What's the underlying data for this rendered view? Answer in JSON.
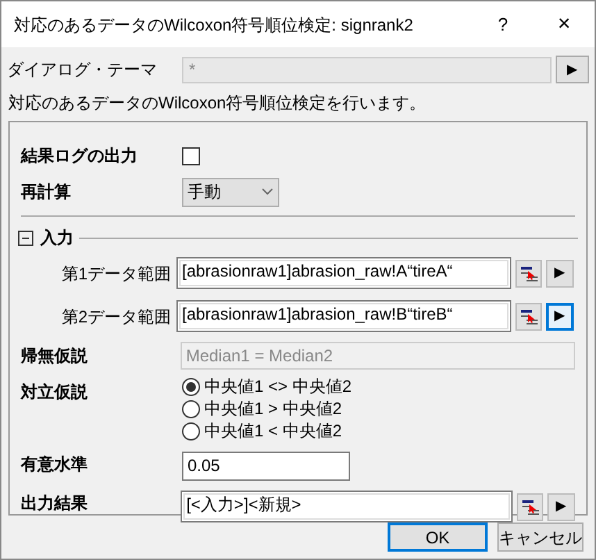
{
  "window": {
    "title": "対応のあるデータのWilcoxon符号順位検定: signrank2",
    "help": "?",
    "close": "×"
  },
  "theme": {
    "label": "ダイアログ・テーマ",
    "value": "*",
    "button": "▶"
  },
  "description": "対応のあるデータのWilcoxon符号順位検定を行います。",
  "fields": [
    {
      "kind": "checkbox",
      "label": "結果ログの出力",
      "checked": false
    },
    {
      "kind": "dropdown",
      "label": "再計算",
      "value": "手動"
    },
    {
      "kind": "section",
      "label": "入力",
      "expanded": true,
      "children": [
        {
          "kind": "range",
          "label": "第1データ範囲",
          "value": "[abrasionraw1]abrasion_raw!A“tireA“",
          "button": "▶",
          "focused": false
        },
        {
          "kind": "range",
          "label": "第2データ範囲",
          "value": "[abrasionraw1]abrasion_raw!B“tireB“",
          "button": "▶",
          "focused": true
        }
      ]
    },
    {
      "kind": "readonly",
      "label": "帰無仮説",
      "value": "Median1 = Median2"
    },
    {
      "kind": "radio",
      "label": "対立仮説",
      "options": [
        {
          "label": "中央値1 <> 中央値2",
          "selected": true
        },
        {
          "label": "中央値1 > 中央値2",
          "selected": false
        },
        {
          "label": "中央値1 < 中央値2",
          "selected": false
        }
      ]
    },
    {
      "kind": "text",
      "label": "有意水準",
      "value": "0.05"
    },
    {
      "kind": "range",
      "label": "出力結果",
      "value": "[<入力>]<新規>",
      "button": "▶",
      "focused": false
    }
  ],
  "buttons": [
    {
      "label": "OK",
      "default": true
    },
    {
      "label": "キャンセル",
      "default": false
    }
  ]
}
